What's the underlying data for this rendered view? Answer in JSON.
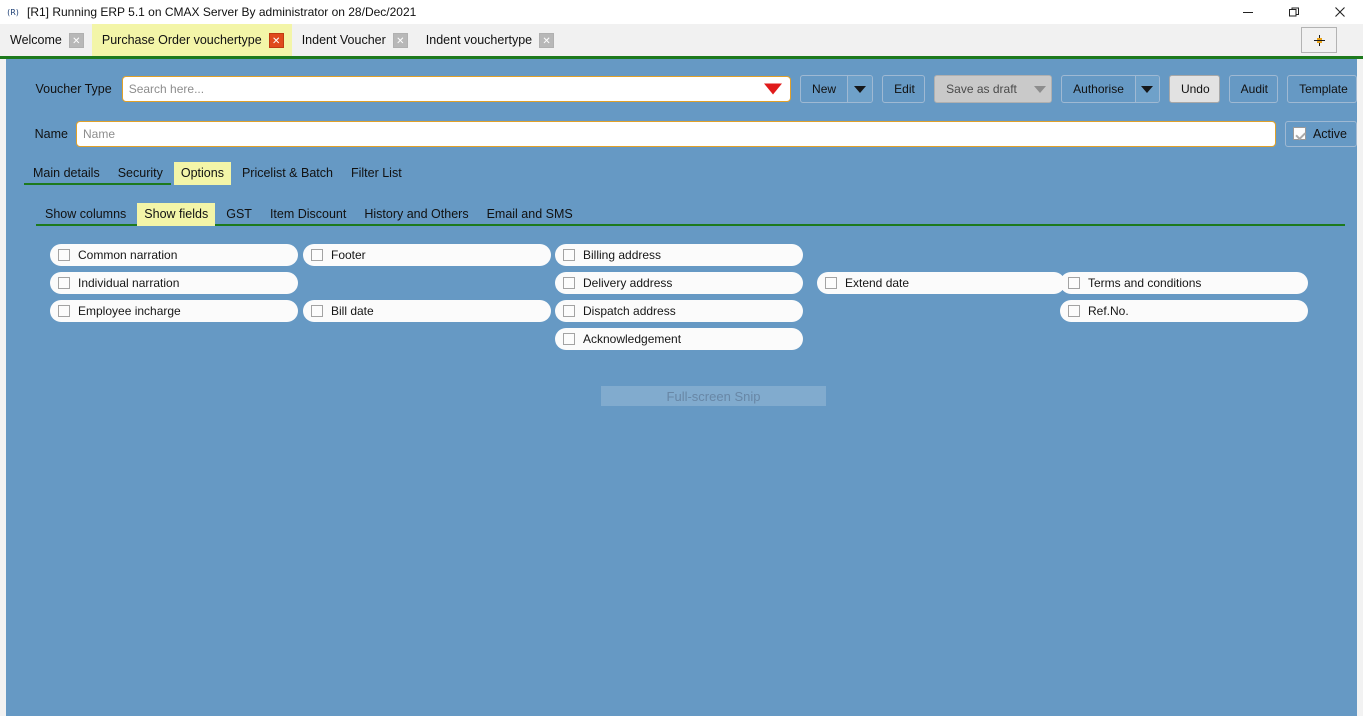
{
  "window": {
    "app_icon": "app-icon",
    "title": "[R1] Running ERP 5.1 on CMAX Server By administrator on 28/Dec/2021",
    "controls": {
      "minimize": "minimize-icon",
      "restore": "restore-icon",
      "close": "close-icon"
    }
  },
  "tabs": {
    "items": [
      {
        "label": "Welcome",
        "active": false,
        "close": "✕"
      },
      {
        "label": "Purchase Order vouchertype",
        "active": true,
        "close": "✕"
      },
      {
        "label": "Indent Voucher",
        "active": false,
        "close": "✕"
      },
      {
        "label": "Indent vouchertype",
        "active": false,
        "close": "✕"
      }
    ],
    "add_tab": "+"
  },
  "toolbar": {
    "voucher_type_label": "Voucher Type",
    "search_placeholder": "Search here...",
    "search_value": "",
    "buttons": {
      "new": "New",
      "edit": "Edit",
      "save_as_draft": "Save as draft",
      "authorise": "Authorise",
      "undo": "Undo",
      "audit": "Audit",
      "template": "Template"
    }
  },
  "name_row": {
    "label": "Name",
    "placeholder": "Name",
    "value": "",
    "active_label": "Active"
  },
  "primary_tabs": [
    {
      "label": "Main details",
      "selected": false
    },
    {
      "label": "Security",
      "selected": false
    },
    {
      "label": "Options",
      "selected": true
    },
    {
      "label": "Pricelist & Batch",
      "selected": false
    },
    {
      "label": "Filter List",
      "selected": false
    }
  ],
  "secondary_tabs": [
    {
      "label": "Show columns",
      "selected": false
    },
    {
      "label": "Show fields",
      "selected": true
    },
    {
      "label": "GST",
      "selected": false
    },
    {
      "label": "Item Discount",
      "selected": false
    },
    {
      "label": "History and Others",
      "selected": false
    },
    {
      "label": "Email and SMS",
      "selected": false
    }
  ],
  "fields": [
    {
      "label": "Common narration",
      "checked": false,
      "col": 0,
      "row": 0
    },
    {
      "label": "Individual narration",
      "checked": false,
      "col": 0,
      "row": 1
    },
    {
      "label": "Employee incharge",
      "checked": false,
      "col": 0,
      "row": 2
    },
    {
      "label": "Footer",
      "checked": false,
      "col": 1,
      "row": 0
    },
    {
      "label": "Bill date",
      "checked": false,
      "col": 1,
      "row": 2
    },
    {
      "label": "Billing address",
      "checked": false,
      "col": 2,
      "row": 0
    },
    {
      "label": "Delivery address",
      "checked": false,
      "col": 2,
      "row": 1
    },
    {
      "label": "Dispatch address",
      "checked": false,
      "col": 2,
      "row": 2
    },
    {
      "label": "Acknowledgement",
      "checked": false,
      "col": 2,
      "row": 3
    },
    {
      "label": "Extend date",
      "checked": false,
      "col": 3,
      "row": 1
    },
    {
      "label": "Terms and conditions",
      "checked": false,
      "col": 4,
      "row": 1
    },
    {
      "label": "Ref.No.",
      "checked": false,
      "col": 4,
      "row": 2
    }
  ],
  "watermark": "Full-screen Snip",
  "colors": {
    "app_background": "#6699c4",
    "active_tab": "#f3f5a8",
    "accent_rule": "#1d7a1d",
    "field_border": "#e0a12a",
    "dropdown_arrow": "#e01b1b",
    "close_tab_active": "#e04a1c"
  }
}
